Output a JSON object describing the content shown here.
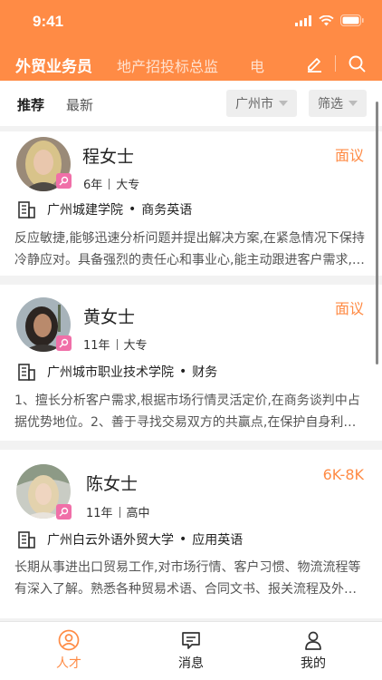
{
  "status": {
    "time": "9:41"
  },
  "tabs": [
    {
      "label": "外贸业务员",
      "active": true
    },
    {
      "label": "地产招投标总监",
      "active": false
    },
    {
      "label": "电",
      "active": false
    }
  ],
  "header_icons": [
    "edit-icon",
    "search-icon"
  ],
  "filter": {
    "tabs": [
      {
        "label": "推荐",
        "active": true
      },
      {
        "label": "最新",
        "active": false
      }
    ],
    "city": "广州市",
    "screen": "筛选"
  },
  "candidates": [
    {
      "name": "程女士",
      "salary": "面议",
      "years": "6年",
      "edu": "大专",
      "school": "广州城建学院",
      "major": "商务英语",
      "desc": "反应敏捷,能够迅速分析问题并提出解决方案,在紧急情况下保持冷静应对。具备强烈的责任心和事业心,能主动跟进客户需求,以优质服务赢得客户信任。"
    },
    {
      "name": "黄女士",
      "salary": "面议",
      "years": "11年",
      "edu": "大专",
      "school": "广州城市职业技术学院",
      "major": "财务",
      "desc": "1、擅长分析客户需求,根据市场行情灵活定价,在商务谈判中占据优势地位。2、善于寻找交易双方的共赢点,在保护自身利益的同时促成合作。"
    },
    {
      "name": "陈女士",
      "salary": "6K-8K",
      "years": "11年",
      "edu": "高中",
      "school": "广州白云外语外贸大学",
      "major": "应用英语",
      "desc": "长期从事进出口贸易工作,对市场行情、客户习惯、物流流程等有深入了解。熟悉各种贸易术语、合同文书、报关流程及外汇结算。"
    }
  ],
  "bottom_nav": [
    {
      "label": "人才",
      "active": true
    },
    {
      "label": "消息",
      "active": false
    },
    {
      "label": "我的",
      "active": false
    }
  ],
  "colors": {
    "accent": "#ff8b45",
    "badge": "#f06fa8"
  }
}
